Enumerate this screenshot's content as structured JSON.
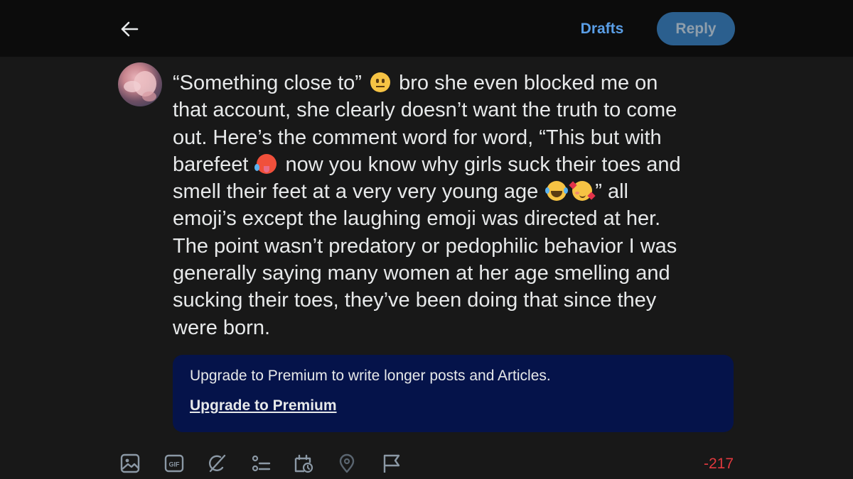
{
  "header": {
    "back_icon": "arrow-left-icon",
    "drafts_label": "Drafts",
    "reply_label": "Reply"
  },
  "post": {
    "lines": [
      [
        "“Something close to”",
        "neutral-face-emoji",
        "bro she even blocked me on"
      ],
      [
        "that account, she clearly doesn’t want the truth to come"
      ],
      [
        "out. Here’s the comment word for word, “This but with"
      ],
      [
        "barefeet",
        "hot-face-emoji",
        "now you know why girls suck their toes and"
      ],
      [
        "smell their feet at a very very young age",
        "laughing-tears-emoji",
        "smiling-hearts-emoji",
        "” all"
      ],
      [
        "emoji’s except the laughing emoji was directed at her."
      ],
      [
        "The point wasn’t predatory or pedophilic behavior I was"
      ],
      [
        "generally saying many women at her age smelling and"
      ],
      [
        "sucking their toes, they’ve been doing that since they"
      ],
      [
        "were born."
      ]
    ]
  },
  "premium": {
    "message": "Upgrade to Premium to write longer posts and Articles.",
    "link_label": "Upgrade to Premium"
  },
  "toolbar": {
    "icons": [
      "image-icon",
      "gif-icon",
      "grok-icon",
      "poll-icon",
      "schedule-icon",
      "location-icon",
      "flag-icon"
    ],
    "gif_text": "GIF"
  },
  "char_counter": "-217",
  "colors": {
    "accent": "#5a9ee6",
    "reply_button": "#2b5f8e",
    "premium_bg": "#05134a",
    "counter_over": "#e0393e",
    "background": "#181818"
  }
}
